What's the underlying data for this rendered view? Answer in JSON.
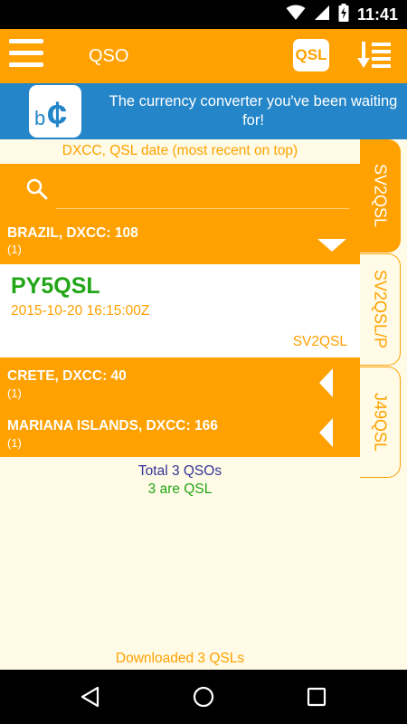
{
  "status_bar": {
    "time": "11:41",
    "icons": [
      "wifi-icon",
      "signal-icon",
      "battery-charging-icon"
    ]
  },
  "toolbar": {
    "title": "QSO",
    "menu_icon": "hamburger-menu-icon",
    "qsl_button_label": "QSL",
    "sort_icon": "sort-descending-icon"
  },
  "ad_banner": {
    "logo_text": "b₵",
    "text": "The currency converter you've been waiting for!"
  },
  "list": {
    "sort_label": "DXCC, QSL date (most recent on top)",
    "search_value": "",
    "groups": [
      {
        "title": "BRAZIL, DXCC: 108",
        "count": "(1)",
        "expanded": true,
        "items": [
          {
            "callsign": "PY5QSL",
            "datetime": "2015-10-20 16:15:00Z",
            "station": "SV2QSL"
          }
        ]
      },
      {
        "title": "CRETE, DXCC: 40",
        "count": "(1)",
        "expanded": false
      },
      {
        "title": "MARIANA ISLANDS, DXCC: 166",
        "count": "(1)",
        "expanded": false
      }
    ],
    "summary_total": "Total 3 QSOs",
    "summary_qsl": "3 are QSL"
  },
  "footer_status": "Downloaded 3 QSLs",
  "station_tabs": [
    {
      "label": "SV2QSL",
      "active": true
    },
    {
      "label": "SV2QSL/P",
      "active": false
    },
    {
      "label": "J49QSL",
      "active": false
    }
  ],
  "nav_bar": {
    "icons": [
      "back-icon",
      "home-icon",
      "recents-icon"
    ]
  },
  "colors": {
    "primary": "#ffa100",
    "ad_blue": "#2486c9",
    "background": "#fffbe6",
    "callsign_green": "#22a616",
    "total_blue": "#333399"
  }
}
